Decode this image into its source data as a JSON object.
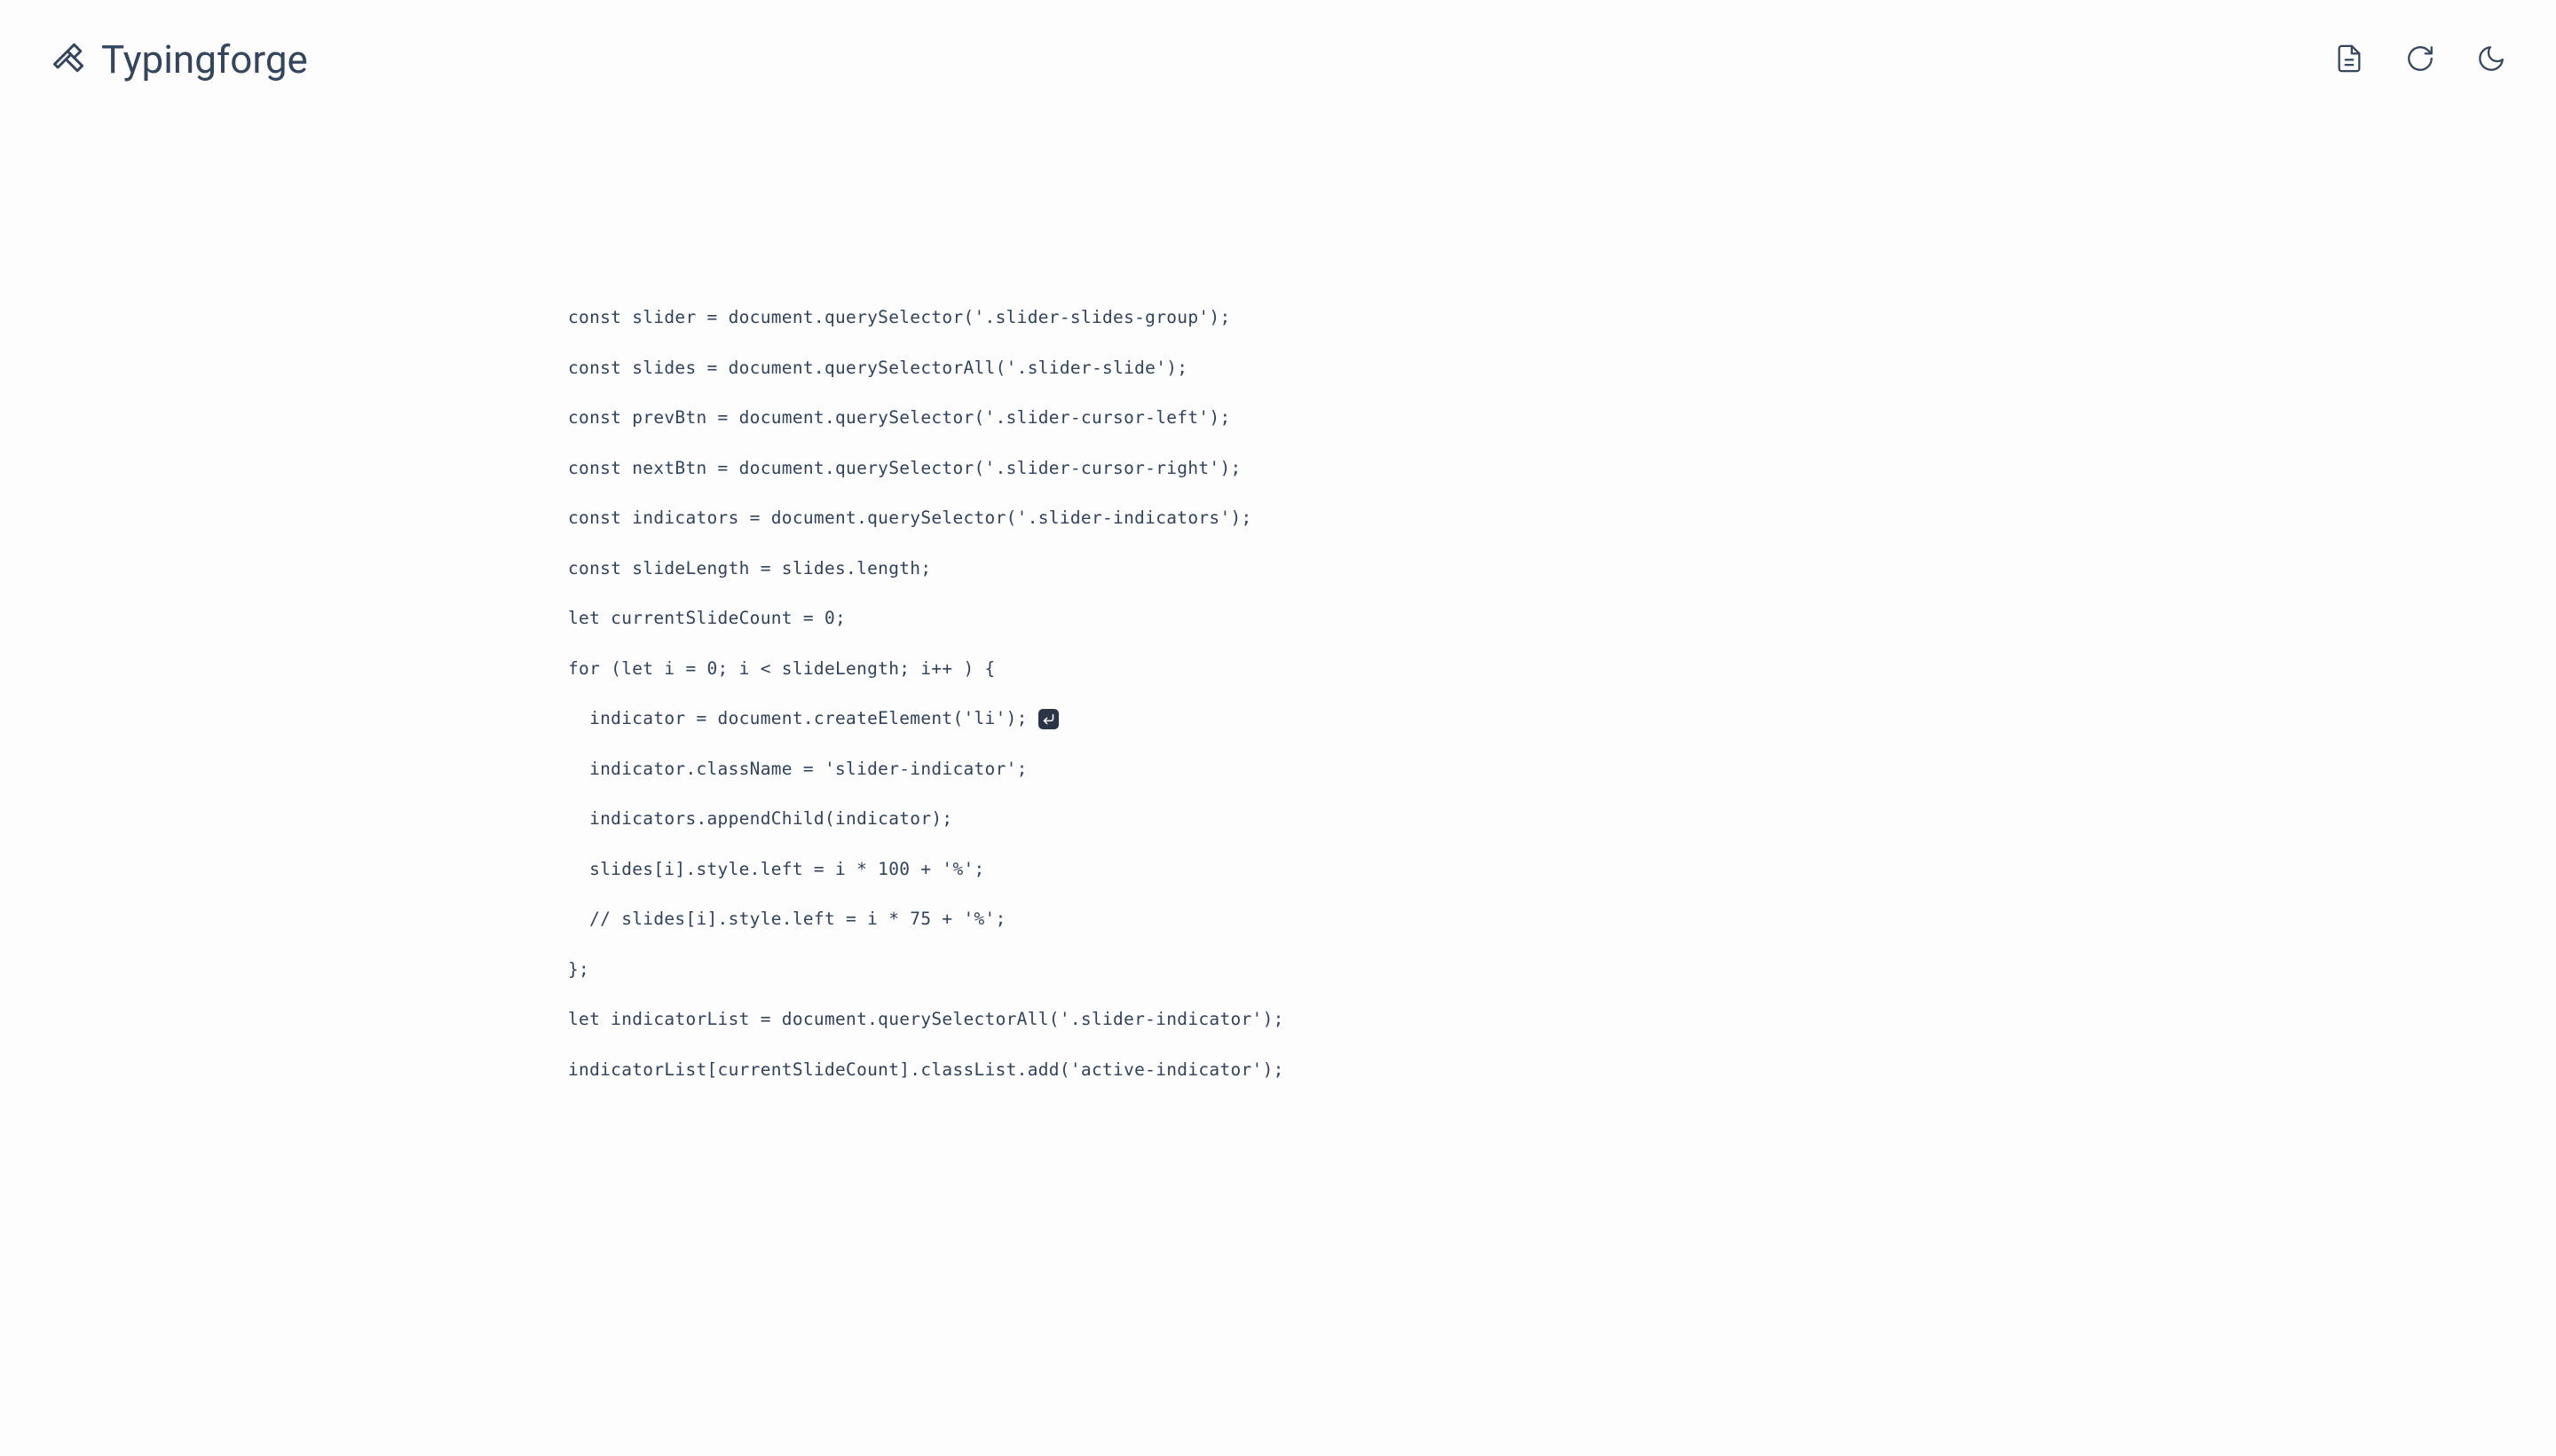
{
  "brand": {
    "name": "Typingforge"
  },
  "code": {
    "lines": [
      "const slider = document.querySelector('.slider-slides-group');",
      "const slides = document.querySelectorAll('.slider-slide');",
      "const prevBtn = document.querySelector('.slider-cursor-left');",
      "const nextBtn = document.querySelector('.slider-cursor-right');",
      "const indicators = document.querySelector('.slider-indicators');",
      "",
      "const slideLength = slides.length;",
      "let currentSlideCount = 0;",
      "",
      "for (let i = 0; i < slideLength; i++ ) {",
      "  indicator = document.createElement('li');",
      "  indicator.className = 'slider-indicator';",
      "  indicators.appendChild(indicator);",
      "",
      "",
      "  slides[i].style.left = i * 100 + '%';",
      "  // slides[i].style.left = i * 75 + '%';",
      "",
      "",
      "};",
      "",
      "let indicatorList = document.querySelectorAll('.slider-indicator');",
      "indicatorList[currentSlideCount].classList.add('active-indicator');"
    ],
    "cursorLine": 10
  }
}
